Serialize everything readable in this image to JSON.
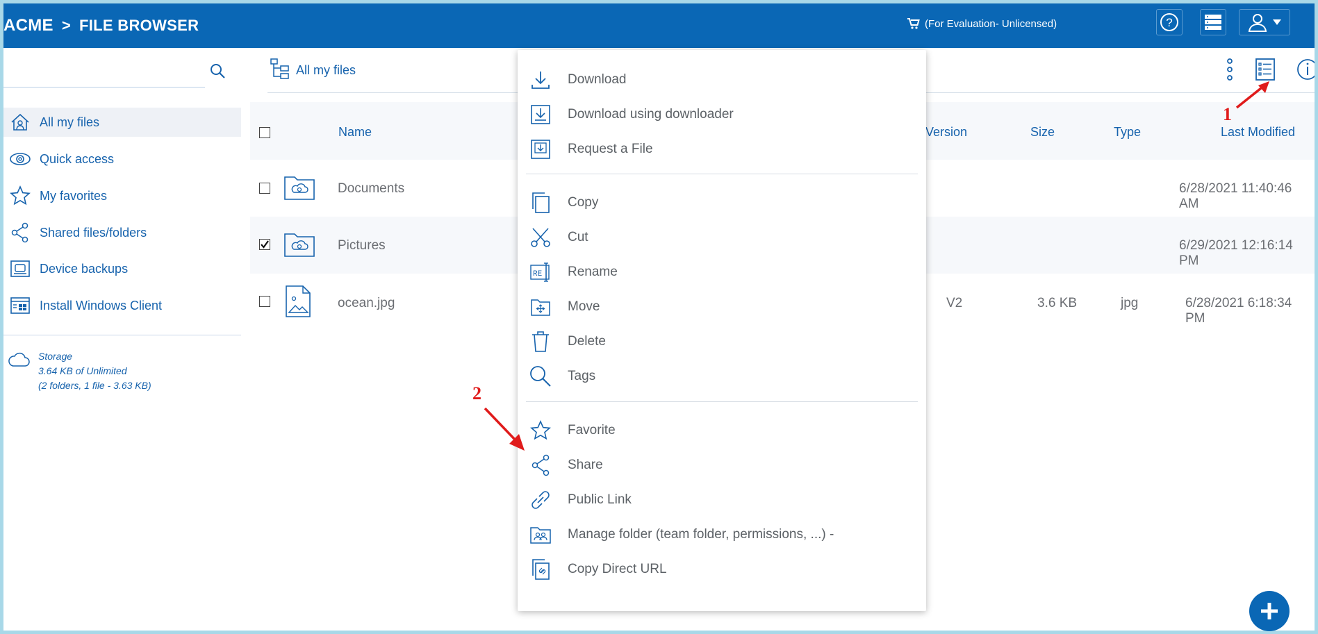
{
  "header": {
    "brand": "ACME",
    "separator": ">",
    "section": "FILE BROWSER",
    "license_text": "(For Evaluation- Unlicensed)",
    "bg_color": "#0a67b5"
  },
  "sidebar": {
    "search_placeholder": "",
    "items": [
      {
        "label": "All my files",
        "icon": "home-icon"
      },
      {
        "label": "Quick access",
        "icon": "eye-icon"
      },
      {
        "label": "My favorites",
        "icon": "star-icon"
      },
      {
        "label": "Shared files/folders",
        "icon": "share-icon"
      },
      {
        "label": "Device backups",
        "icon": "device-backup-icon"
      },
      {
        "label": "Install Windows Client",
        "icon": "windows-client-icon"
      }
    ],
    "storage": {
      "title": "Storage",
      "usage": "3.64 KB of Unlimited",
      "details": "(2 folders, 1 file - 3.63 KB)"
    }
  },
  "main": {
    "breadcrumb": "All my files",
    "columns": {
      "name": "Name",
      "version": "Version",
      "size": "Size",
      "type": "Type",
      "last_modified": "Last Modified"
    },
    "rows": [
      {
        "name": "Documents",
        "version": "",
        "size": "",
        "type": "",
        "modified": "6/28/2021 11:40:46 AM",
        "checked": false,
        "icon": "folder-icon"
      },
      {
        "name": "Pictures",
        "version": "",
        "size": "",
        "type": "",
        "modified": "6/29/2021 12:16:14 PM",
        "checked": true,
        "icon": "folder-icon"
      },
      {
        "name": "ocean.jpg",
        "version": "V2",
        "size": "3.6 KB",
        "type": "jpg",
        "modified": "6/28/2021 6:18:34 PM",
        "checked": false,
        "icon": "image-file-icon"
      }
    ]
  },
  "context_menu": {
    "groups": [
      [
        {
          "label": "Download",
          "icon": "download-icon"
        },
        {
          "label": "Download using downloader",
          "icon": "downloader-icon"
        },
        {
          "label": "Request a File",
          "icon": "request-file-icon"
        }
      ],
      [
        {
          "label": "Copy",
          "icon": "copy-icon"
        },
        {
          "label": "Cut",
          "icon": "scissors-icon"
        },
        {
          "label": "Rename",
          "icon": "rename-icon"
        },
        {
          "label": "Move",
          "icon": "move-icon"
        },
        {
          "label": "Delete",
          "icon": "trash-icon"
        },
        {
          "label": "Tags",
          "icon": "search-icon"
        }
      ],
      [
        {
          "label": "Favorite",
          "icon": "star-icon"
        },
        {
          "label": "Share",
          "icon": "share-icon"
        },
        {
          "label": "Public Link",
          "icon": "link-icon"
        },
        {
          "label": "Manage folder (team folder, permissions, ...) -",
          "icon": "manage-folder-icon"
        },
        {
          "label": "Copy Direct URL",
          "icon": "direct-url-icon"
        }
      ]
    ]
  },
  "annotations": {
    "marker_1": "1",
    "marker_2": "2",
    "color": "#e01b1b"
  }
}
